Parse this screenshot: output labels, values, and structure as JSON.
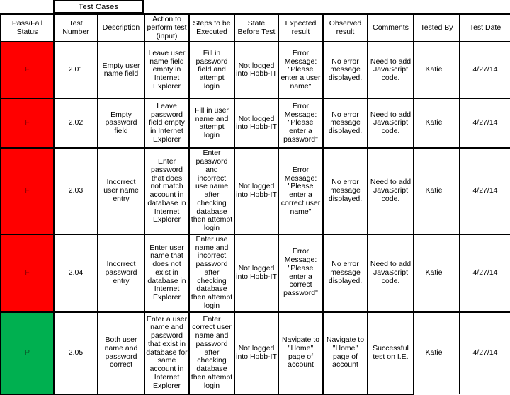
{
  "title": "Test Cases",
  "columns": [
    "Pass/Fail Status",
    "Test Number",
    "Description",
    "Action to perform test (input)",
    "Steps to be Executed",
    "State Before Test",
    "Expected result",
    "Observed result",
    "Comments",
    "Tested By",
    "Test Date"
  ],
  "colors": {
    "fail_bg": "#FF0000",
    "fail_fg": "#8B0000",
    "pass_bg": "#00B050",
    "pass_fg": "#0A5C2A",
    "grid": "#000000",
    "background": "#FFFFFF"
  },
  "rows": [
    {
      "status": "F",
      "status_kind": "fail",
      "test_number": "2.01",
      "description": "Empty user name field",
      "action": "Leave user name field empty in Internet Explorer",
      "steps": "Fill in password field and attempt login",
      "state_before": "Not logged into Hobb-IT",
      "expected": "Error Message: \"Please enter a user name\"",
      "observed": "No error message displayed.",
      "comments": "Need to add JavaScript code.",
      "tested_by": "Katie",
      "test_date": "4/27/14"
    },
    {
      "status": "F",
      "status_kind": "fail",
      "test_number": "2.02",
      "description": "Empty password field",
      "action": "Leave password field empty in Internet Explorer",
      "steps": "Fill in user name and attempt login",
      "state_before": "Not logged into Hobb-IT",
      "expected": "Error Message: \"Please enter a password\"",
      "observed": "No error message displayed.",
      "comments": "Need to add JavaScript code.",
      "tested_by": "Katie",
      "test_date": "4/27/14"
    },
    {
      "status": "F",
      "status_kind": "fail",
      "test_number": "2.03",
      "description": "Incorrect user name entry",
      "action": "Enter password that does not match account in database in Internet Explorer",
      "steps": "Enter password and incorrect use name after checking database then attempt login",
      "state_before": "Not logged into Hobb-IT",
      "expected": "Error Message: \"Please enter a correct user name\"",
      "observed": "No error message displayed.",
      "comments": "Need to add JavaScript code.",
      "tested_by": "Katie",
      "test_date": "4/27/14"
    },
    {
      "status": "F",
      "status_kind": "fail",
      "test_number": "2.04",
      "description": "Incorrect password entry",
      "action": "Enter user name that does not exist in database in Internet Explorer",
      "steps": "Enter use name and incorrect password after checking database then attempt login",
      "state_before": "Not logged into Hobb-IT",
      "expected": "Error Message: \"Please enter a correct password\"",
      "observed": "No error message displayed.",
      "comments": "Need to add JavaScript code.",
      "tested_by": "Katie",
      "test_date": "4/27/14"
    },
    {
      "status": "P",
      "status_kind": "pass",
      "test_number": "2.05",
      "description": "Both user name and password correct",
      "action": "Enter a user name and password that exist in database for same account in Internet Explorer",
      "steps": "Enter correct user name and password after checking database then attempt login",
      "state_before": "Not logged into Hobb-IT",
      "expected": "Navigate to \"Home\" page of account",
      "observed": "Navigate to \"Home\" page of account",
      "comments": "Successful test on I.E.",
      "tested_by": "Katie",
      "test_date": "4/27/14"
    }
  ]
}
